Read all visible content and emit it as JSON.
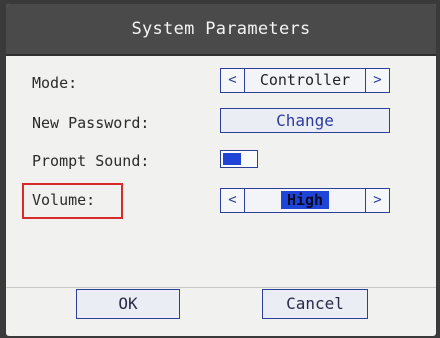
{
  "window": {
    "title": "System Parameters"
  },
  "rows": {
    "mode": {
      "label": "Mode:",
      "value": "Controller",
      "prev": "<",
      "next": ">"
    },
    "password": {
      "label": "New Password:",
      "button": "Change"
    },
    "prompt_sound": {
      "label": "Prompt Sound:",
      "state": "on"
    },
    "volume": {
      "label": "Volume:",
      "value": "High",
      "prev": "<",
      "next": ">"
    }
  },
  "footer": {
    "ok": "OK",
    "cancel": "Cancel"
  },
  "colors": {
    "accent": "#1f45d8",
    "frame": "#2c3f9a",
    "highlight_box": "#d82a2a",
    "title_bg": "#4a4a4a"
  }
}
